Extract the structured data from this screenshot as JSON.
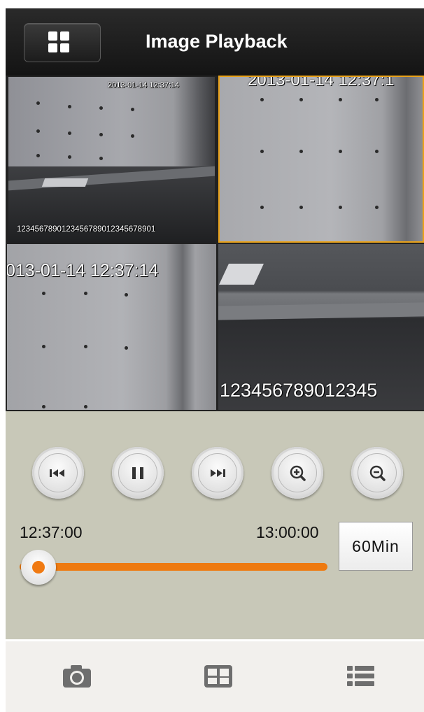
{
  "header": {
    "title": "Image Playback",
    "layout_button_icon": "grid-4-icon"
  },
  "video": {
    "cameras": [
      {
        "timestamp": "2013-01-14 12:37:14",
        "caption": "1234567890123456789012345678901",
        "selected": false
      },
      {
        "timestamp": "2013-01-14 12:37:1",
        "caption": "",
        "selected": true
      },
      {
        "timestamp": "013-01-14 12:37:14",
        "caption": "",
        "selected": false
      },
      {
        "timestamp": "",
        "caption": "123456789012345",
        "selected": false
      }
    ],
    "selected_border_color": "#e9a21a"
  },
  "controls": {
    "buttons": [
      {
        "icon": "skip-previous-icon"
      },
      {
        "icon": "pause-icon"
      },
      {
        "icon": "skip-next-icon"
      },
      {
        "icon": "zoom-in-icon"
      },
      {
        "icon": "zoom-out-icon"
      }
    ],
    "start_time": "12:37:00",
    "end_time": "13:00:00",
    "range_label": "60Min",
    "slider_position": 0.06,
    "accent_color": "#ee7a10"
  },
  "bottom_bar": {
    "items": [
      {
        "icon": "camera-icon"
      },
      {
        "icon": "layout-grid-icon"
      },
      {
        "icon": "list-icon"
      }
    ]
  }
}
